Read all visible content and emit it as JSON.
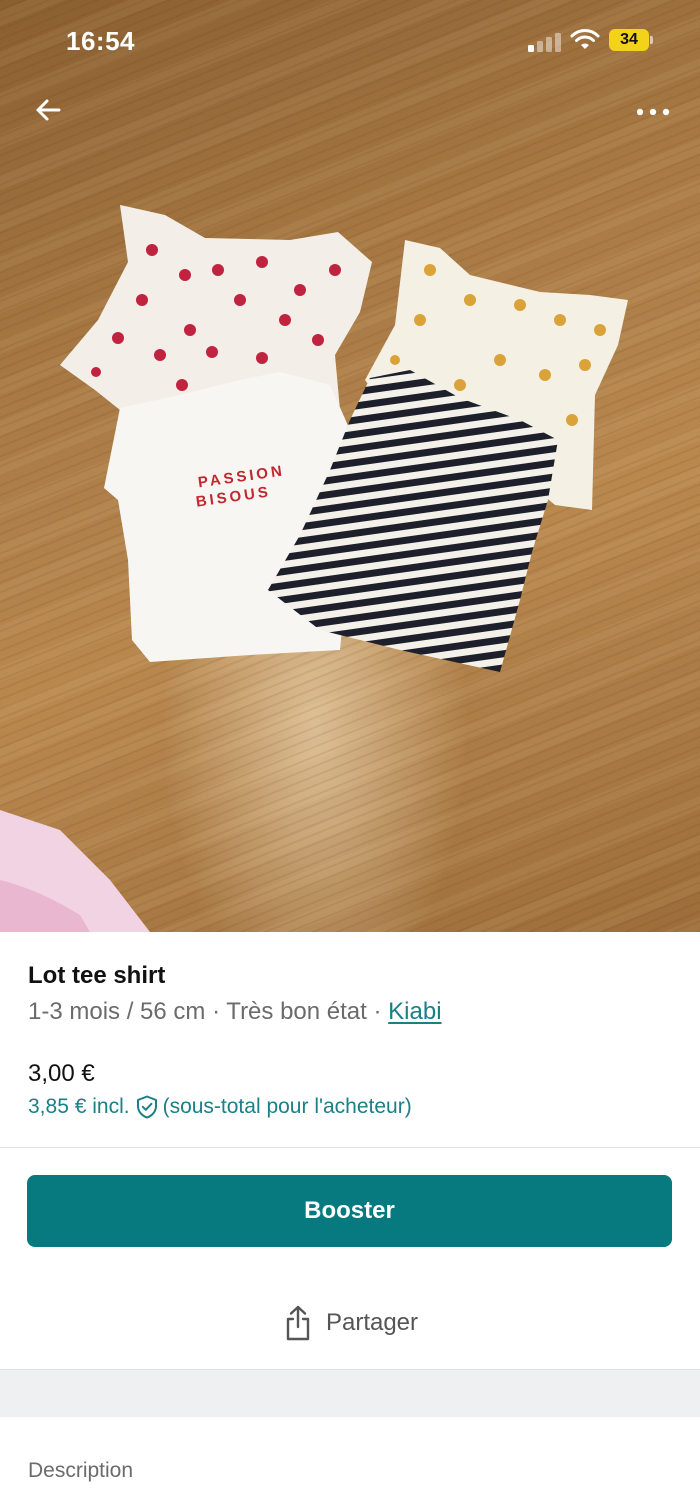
{
  "status_bar": {
    "time": "16:54",
    "battery_level": "34",
    "battery_color": "#f2d21b"
  },
  "photo": {
    "shirt_print_text": [
      "PASSION",
      "BISOUS"
    ]
  },
  "item": {
    "title": "Lot tee shirt",
    "size": "1-3 mois / 56 cm",
    "separator": "·",
    "condition": "Très bon état",
    "brand": "Kiabi",
    "price": "3,00 €",
    "buyer_price": "3,85 € incl.",
    "buyer_price_note": "(sous-total pour l'acheteur)"
  },
  "actions": {
    "booster_label": "Booster",
    "share_label": "Partager"
  },
  "sections": {
    "description_label": "Description"
  },
  "colors": {
    "accent": "#077a80",
    "link": "#1a7f86",
    "muted_text": "#6b6b6b"
  },
  "icons": [
    "arrow-left-icon",
    "more-dots-icon",
    "signal-icon",
    "wifi-icon",
    "battery-icon",
    "shield-check-icon",
    "share-icon"
  ]
}
